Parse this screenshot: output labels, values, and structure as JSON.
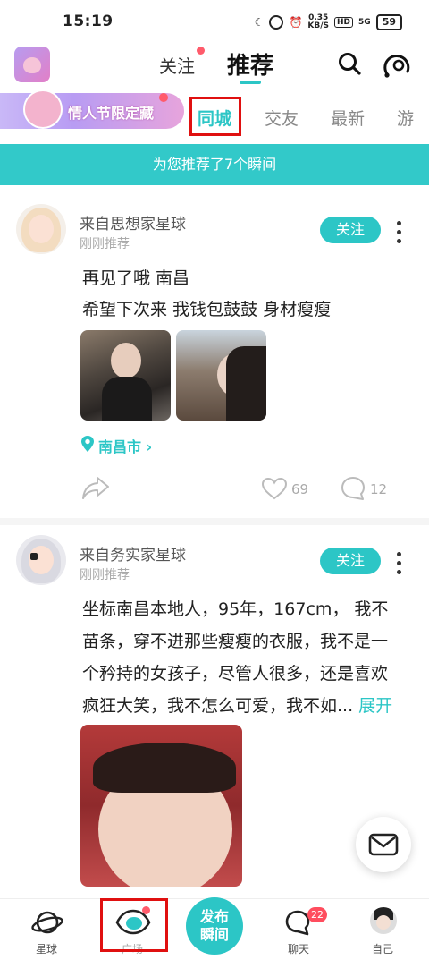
{
  "status_bar": {
    "time": "15:19",
    "speed_value": "0.35",
    "speed_unit": "KB/S",
    "hd": "HD",
    "network": "5G",
    "battery": "59"
  },
  "header": {
    "tab_follow": "关注",
    "tab_recommend": "推荐"
  },
  "categories": {
    "banner_text": "情人节限定藏",
    "items": [
      "同城",
      "交友",
      "最新",
      "游"
    ],
    "active_index": 0
  },
  "notice": "为您推荐了7个瞬间",
  "posts": [
    {
      "name": "来自思想家星球",
      "time": "刚刚推荐",
      "follow_label": "关注",
      "lines": [
        "再见了哦  南昌",
        "希望下次来  我钱包鼓鼓  身材瘦瘦"
      ],
      "location": "南昌市",
      "likes": "69",
      "comments": "12"
    },
    {
      "name": "来自务实家星球",
      "time": "刚刚推荐",
      "follow_label": "关注",
      "lines": [
        "坐标南昌本地人，95年，167cm，  我不",
        "苗条，穿不进那些瘦瘦的衣服，我不是一",
        "个矜持的女孩子，尽管人很多，还是喜欢",
        "疯狂大笑，我不怎么可爱，我不如..."
      ],
      "expand_label": "展开"
    }
  ],
  "bottom_nav": {
    "items": [
      "星球",
      "广场",
      "聊天",
      "自己"
    ],
    "publish_label": [
      "发布",
      "瞬间"
    ],
    "chat_badge": "22"
  },
  "colors": {
    "accent": "#2cc6c6",
    "badge": "#ff4d5e"
  }
}
